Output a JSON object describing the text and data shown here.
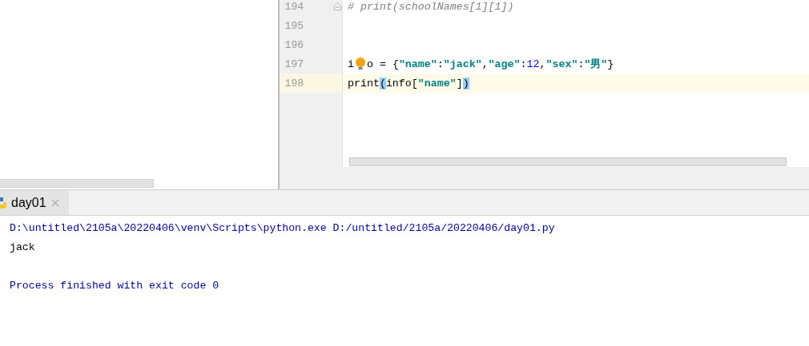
{
  "editor": {
    "lines": [
      {
        "number": "194",
        "current": false,
        "fold": true,
        "tokens": [
          {
            "kind": "comment",
            "text": "# print(schoolNames[1][1])"
          }
        ]
      },
      {
        "number": "195",
        "current": false
      },
      {
        "number": "196",
        "current": false
      },
      {
        "number": "197",
        "current": false,
        "tokens": [
          {
            "kind": "plain",
            "text": "i"
          },
          {
            "kind": "bulb"
          },
          {
            "kind": "plain",
            "text": "o = {"
          },
          {
            "kind": "string",
            "text": "\"name\""
          },
          {
            "kind": "plain",
            "text": ":"
          },
          {
            "kind": "string",
            "text": "\"jack\""
          },
          {
            "kind": "plain",
            "text": ","
          },
          {
            "kind": "string",
            "text": "\"age\""
          },
          {
            "kind": "plain",
            "text": ":"
          },
          {
            "kind": "number",
            "text": "12"
          },
          {
            "kind": "plain",
            "text": ","
          },
          {
            "kind": "string",
            "text": "\"sex\""
          },
          {
            "kind": "plain",
            "text": ":"
          },
          {
            "kind": "string",
            "text": "\"男\""
          },
          {
            "kind": "plain",
            "text": "}"
          }
        ]
      },
      {
        "number": "198",
        "current": true,
        "tokens": [
          {
            "kind": "plain",
            "text": "print"
          },
          {
            "kind": "match",
            "text": "("
          },
          {
            "kind": "plain",
            "text": "info["
          },
          {
            "kind": "string",
            "text": "\"name\""
          },
          {
            "kind": "plain",
            "text": "]"
          },
          {
            "kind": "match",
            "text": ")"
          }
        ]
      }
    ]
  },
  "run_panel": {
    "tabs": [
      {
        "label": "day01",
        "selected": true
      }
    ],
    "output": [
      {
        "kind": "system",
        "text": "D:\\untitled\\2105a\\20220406\\venv\\Scripts\\python.exe D:/untitled/2105a/20220406/day01.py"
      },
      {
        "kind": "stdout",
        "text": "jack"
      },
      {
        "kind": "blank"
      },
      {
        "kind": "system",
        "text": "Process finished with exit code 0"
      }
    ]
  }
}
